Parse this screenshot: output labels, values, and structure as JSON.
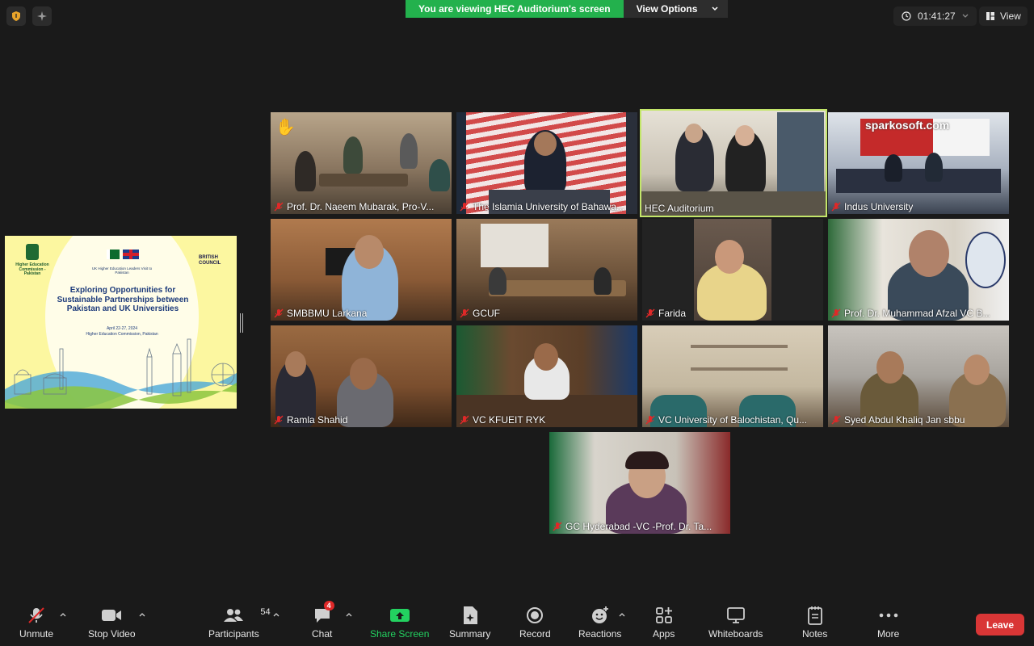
{
  "top": {
    "share_text": "You are viewing HEC Auditorium's screen",
    "view_options": "View Options",
    "timer": "01:41:27",
    "view_label": "View"
  },
  "slide": {
    "logo_left": "Higher Education Commission - Pakistan",
    "logo_right": "BRITISH COUNCIL",
    "subtitle": "UK Higher Education Leaders Visit to Pakistan",
    "title": "Exploring Opportunities for Sustainable Partnerships between Pakistan and UK Universities",
    "dates": "April 22-27, 2024",
    "venue": "Higher Education Commission, Pakistan"
  },
  "tiles": [
    {
      "name": "Prof. Dr. Naeem Mubarak, Pro-V...",
      "hand": true
    },
    {
      "name": "The Islamia University of Bahawa..."
    },
    {
      "name": "HEC Auditorium",
      "active": true
    },
    {
      "name": "Indus University",
      "watermark": "sparkosoft.com"
    },
    {
      "name": "SMBBMU Larkana"
    },
    {
      "name": "GCUF"
    },
    {
      "name": "Farida"
    },
    {
      "name": "Prof. Dr. Muhammad Afzal VC B..."
    },
    {
      "name": "Ramla Shahid"
    },
    {
      "name": "VC KFUEIT RYK"
    },
    {
      "name": "VC University of Balochistan, Qu..."
    },
    {
      "name": "Syed Abdul Khaliq Jan sbbu"
    },
    {
      "name": "GC Hyderabad -VC -Prof. Dr. Ta..."
    }
  ],
  "toolbar": {
    "unmute": "Unmute",
    "stop_video": "Stop Video",
    "participants": "Participants",
    "participants_count": "54",
    "chat": "Chat",
    "chat_badge": "4",
    "share_screen": "Share Screen",
    "summary": "Summary",
    "record": "Record",
    "reactions": "Reactions",
    "apps": "Apps",
    "whiteboards": "Whiteboards",
    "notes": "Notes",
    "more": "More",
    "leave": "Leave"
  },
  "colors": {
    "background": "#1a1a1a",
    "share_green": "#23b14d",
    "active_outline": "#c3e66a",
    "leave_red": "#d93636"
  }
}
